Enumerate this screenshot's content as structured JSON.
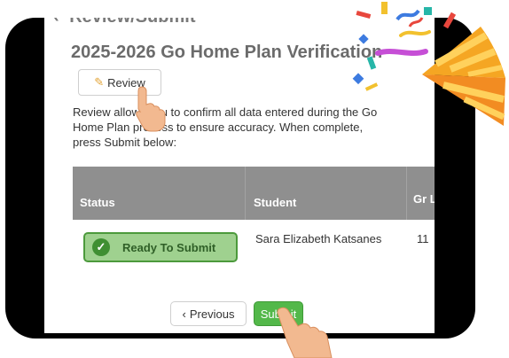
{
  "header": {
    "partial_title": "Review/Submit"
  },
  "page": {
    "title": "2025-2026 Go Home Plan Verification"
  },
  "toolbar": {
    "review_label": "Review"
  },
  "description": "Review allows you to confirm all data entered during the Go Home Plan process to ensure accuracy. When complete, press Submit below:",
  "table": {
    "columns": [
      "Status",
      "Student",
      "Gr Le"
    ],
    "rows": [
      {
        "status": "Ready To Submit",
        "student": "Sara Elizabeth Katsanes",
        "grade": "11"
      }
    ]
  },
  "footer": {
    "previous_label": "Previous",
    "submit_label": "Submit"
  },
  "colors": {
    "table_header": "#8f8f8f",
    "ready_badge": "#9fd18f",
    "submit_button": "#53b84a",
    "title_text": "#6b6b6b"
  },
  "icons": [
    "back-icon",
    "pencil-icon",
    "check-icon",
    "chevron-left-icon",
    "hand-pointer-icon",
    "party-popper-icon"
  ]
}
